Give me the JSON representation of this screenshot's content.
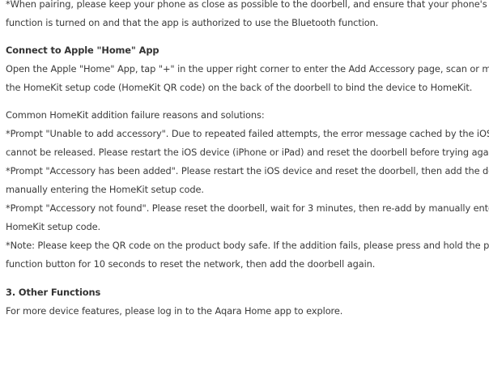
{
  "intro": {
    "lines": [
      "*When pairing, please keep your phone as close as possible to the doorbell, and ensure that your phone's Bl",
      "function is turned on and that the app is authorized to use the Bluetooth function."
    ]
  },
  "homekit": {
    "heading": "Connect to Apple \"Home\" App",
    "lines": [
      "Open the Apple \"Home\" App, tap \"+\" in the upper right corner to enter the Add Accessory page, scan or man",
      "the HomeKit setup code (HomeKit QR code) on the back of the doorbell to bind the device to HomeKit."
    ]
  },
  "failures": {
    "lines": [
      "Common HomeKit addition failure reasons and solutions:",
      "*Prompt \"Unable to add accessory\". Due to repeated failed attempts, the error message cached by the iOS s",
      "cannot be released. Please restart the iOS device (iPhone or iPad) and reset the doorbell before trying again",
      "*Prompt \"Accessory has been added\". Please restart the iOS device and reset the doorbell, then add the dev",
      "manually entering the HomeKit setup code.",
      "*Prompt \"Accessory not found\". Please reset the doorbell, wait for 3 minutes, then re-add by manually enter",
      "HomeKit setup code.",
      "*Note: Please keep the QR code on the product body safe. If the addition fails, please press and hold the pro",
      "function button for 10 seconds to reset the network, then add the doorbell again."
    ]
  },
  "other": {
    "heading": "3. Other Functions",
    "lines": [
      "For more device features, please log in to the Aqara Home app to explore."
    ]
  }
}
